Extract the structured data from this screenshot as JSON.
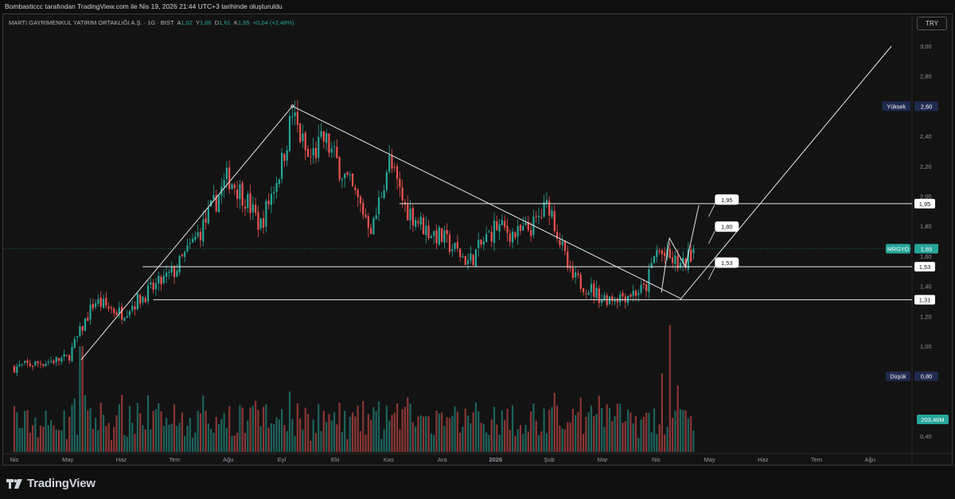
{
  "header": {
    "attribution": "Bombasticcc tarafından TradingView.com ile Nis 19, 2026 21:44 UTC+3 tarihinde oluşturuldu"
  },
  "legend": {
    "symbol": "MARTI GAYRİMENKUL YATIRIM ORTAKLIĞI A.Ş. · 1G · BIST",
    "open_label": "A",
    "open": "1,62",
    "high_label": "Y",
    "high": "1,66",
    "low_label": "D",
    "low": "1,61",
    "close_label": "K",
    "close": "1,65",
    "change": "+0,04 (+2,48%)"
  },
  "currency": "TRY",
  "brand": {
    "name": "TradingView"
  },
  "colors": {
    "up": "#26a69a",
    "down": "#ef5350",
    "line": "#e8e8e8",
    "background": "#131313"
  },
  "chart_data": {
    "type": "candlestick",
    "ylim": [
      0.4,
      3.05
    ],
    "y_ticks": [
      "3,00",
      "2,80",
      "2,60",
      "2,40",
      "2,20",
      "2,00",
      "1,80",
      "1,60",
      "1,40",
      "1,20",
      "1,00",
      "0,40"
    ],
    "y_tick_values": [
      3.0,
      2.8,
      2.6,
      2.4,
      2.2,
      2.0,
      1.8,
      1.6,
      1.4,
      1.2,
      1.0,
      0.4
    ],
    "x_labels": [
      "Nis",
      "May",
      "Haz",
      "Tem",
      "Ağu",
      "Eyl",
      "Eki",
      "Kas",
      "Ara",
      "2026",
      "Şub",
      "Mar",
      "Nis",
      "May",
      "Haz",
      "Tem",
      "Ağu"
    ],
    "x_label_months": [
      0,
      1,
      2,
      3,
      4,
      5,
      6,
      7,
      8,
      9,
      10,
      11,
      12,
      13,
      14,
      15,
      16
    ],
    "price_labels": [
      {
        "name": "Yüksek",
        "value": "2,60",
        "level": 2.6,
        "kind": "high"
      },
      {
        "name": "Düşük",
        "value": "0,80",
        "level": 0.8,
        "kind": "low"
      },
      {
        "name": "MRGYO",
        "value": "1,65",
        "level": 1.65,
        "kind": "last"
      },
      {
        "name": "",
        "value": "1,95",
        "level": 1.95,
        "kind": "level"
      },
      {
        "name": "",
        "value": "1,53",
        "level": 1.53,
        "kind": "level"
      },
      {
        "name": "",
        "value": "1,31",
        "level": 1.31,
        "kind": "level"
      }
    ],
    "volume_label": "203,46M",
    "callouts": [
      {
        "text": "1,95",
        "month": 13.1,
        "price": 1.98
      },
      {
        "text": "1,80",
        "month": 13.1,
        "price": 1.8
      },
      {
        "text": "1,53",
        "month": 13.1,
        "price": 1.56
      }
    ],
    "horizontal_levels": [
      {
        "value": 1.95,
        "from_month": 7.2
      },
      {
        "value": 1.53,
        "from_month": 2.4
      },
      {
        "value": 1.31,
        "from_month": 2.6
      }
    ],
    "trend_lines": [
      {
        "points": [
          [
            1.25,
            0.91
          ],
          [
            5.2,
            2.6
          ]
        ]
      },
      {
        "points": [
          [
            5.2,
            2.6
          ],
          [
            12.45,
            1.32
          ]
        ]
      },
      {
        "points": [
          [
            12.1,
            1.36
          ],
          [
            12.25,
            1.72
          ],
          [
            12.55,
            1.53
          ],
          [
            12.8,
            1.94
          ]
        ]
      },
      {
        "points": [
          [
            12.45,
            1.31
          ],
          [
            16.4,
            3.0
          ]
        ]
      }
    ],
    "anchors": {
      "months": [
        0,
        1,
        1.5,
        2,
        2.5,
        3,
        3.5,
        4,
        4.3,
        4.6,
        5,
        5.2,
        5.5,
        5.8,
        6.3,
        6.7,
        7,
        7.3,
        7.7,
        8,
        8.5,
        9,
        9.4,
        9.7,
        10,
        10.4,
        10.7,
        11,
        11.4,
        11.8,
        12,
        12.25,
        12.5,
        12.7
      ],
      "close": [
        0.86,
        0.92,
        1.3,
        1.22,
        1.36,
        1.5,
        1.78,
        2.13,
        2.0,
        1.8,
        2.22,
        2.55,
        2.24,
        2.38,
        2.05,
        1.78,
        2.24,
        1.93,
        1.78,
        1.72,
        1.56,
        1.8,
        1.74,
        1.8,
        1.95,
        1.46,
        1.4,
        1.32,
        1.34,
        1.38,
        1.64,
        1.58,
        1.53,
        1.65
      ]
    },
    "candle_count": 260,
    "last_month": 12.7,
    "volume_spikes": [
      [
        1.25,
        3.5
      ],
      [
        4.5,
        1.7
      ],
      [
        5.15,
        2.0
      ],
      [
        7.3,
        1.5
      ],
      [
        10.6,
        1.8
      ],
      [
        11.3,
        1.6
      ],
      [
        12.1,
        2.6
      ],
      [
        12.25,
        4.2
      ],
      [
        12.4,
        2.2
      ]
    ]
  }
}
